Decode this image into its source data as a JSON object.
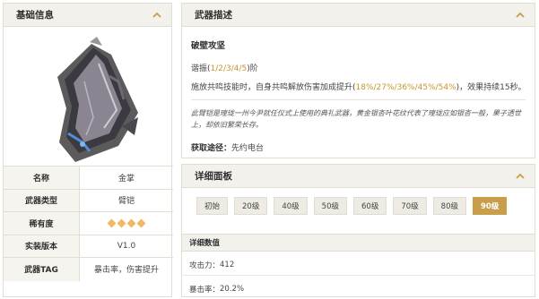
{
  "basic_info": {
    "title": "基础信息",
    "rows": [
      {
        "label": "名称",
        "value": "金掌"
      },
      {
        "label": "武器类型",
        "value": "臂铠"
      },
      {
        "label": "稀有度",
        "stars": 4
      },
      {
        "label": "实装版本",
        "value": "V1.0"
      },
      {
        "label": "武器TAG",
        "value": "暴击率，伤害提升"
      }
    ]
  },
  "description": {
    "title": "武器描述",
    "skill_name": "破壁攻坚",
    "tier_prefix": "谐振(",
    "tier_values": "1/2/3/4/5",
    "tier_suffix": ")阶",
    "effect_prefix": "施放共鸣技能时，自身共鸣解放伤害加成提升(",
    "effect_values": "18%/27%/36%/45%/54%",
    "effect_suffix": ")，效果持续15秒。",
    "lore": "此臂铠是瑝珑一州今尹就任仪式上使用的典礼武器，黄金银杏叶花纹代表了瑝珑应如银杏一般，果子透世上，却依旧繁荣长存。",
    "obtain_label": "获取途径：",
    "obtain_value": "先约电台"
  },
  "detail": {
    "title": "详细面板",
    "levels": [
      "初始",
      "20级",
      "40级",
      "50级",
      "60级",
      "70级",
      "80级",
      "90级"
    ],
    "active_level": "90级",
    "subheader": "详细数值",
    "stats": [
      {
        "label": "攻击力：",
        "value": "412"
      },
      {
        "label": "暴击率：",
        "value": "20.2%"
      }
    ]
  },
  "colors": {
    "accent_gold": "#c89e4a",
    "star": "#f0b862",
    "highlight_text": "#c9962f",
    "header_bg": "#f3f1ec"
  },
  "icons": {
    "collapse": "chevron-up-icon",
    "weapon": "weapon-gauntlet-image"
  }
}
